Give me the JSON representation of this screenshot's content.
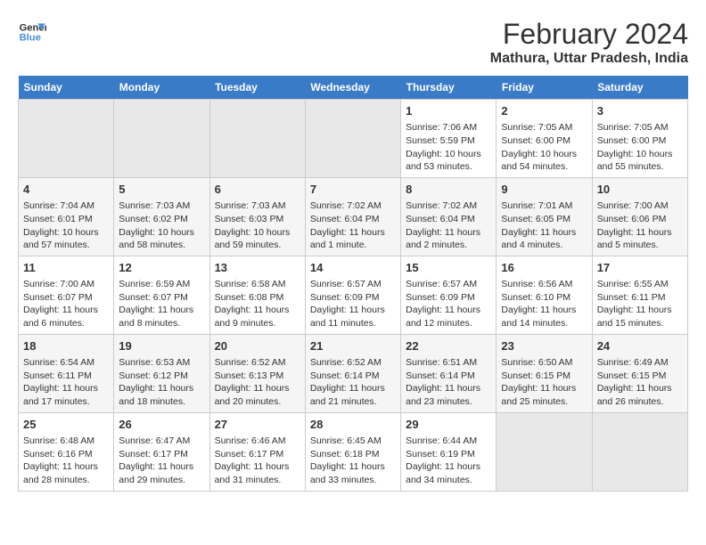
{
  "logo": {
    "line1": "General",
    "line2": "Blue"
  },
  "title": "February 2024",
  "subtitle": "Mathura, Uttar Pradesh, India",
  "headers": [
    "Sunday",
    "Monday",
    "Tuesday",
    "Wednesday",
    "Thursday",
    "Friday",
    "Saturday"
  ],
  "weeks": [
    [
      {
        "day": "",
        "empty": true
      },
      {
        "day": "",
        "empty": true
      },
      {
        "day": "",
        "empty": true
      },
      {
        "day": "",
        "empty": true
      },
      {
        "day": "1",
        "sunrise": "7:06 AM",
        "sunset": "5:59 PM",
        "daylight": "10 hours and 53 minutes."
      },
      {
        "day": "2",
        "sunrise": "7:05 AM",
        "sunset": "6:00 PM",
        "daylight": "10 hours and 54 minutes."
      },
      {
        "day": "3",
        "sunrise": "7:05 AM",
        "sunset": "6:00 PM",
        "daylight": "10 hours and 55 minutes."
      }
    ],
    [
      {
        "day": "4",
        "sunrise": "7:04 AM",
        "sunset": "6:01 PM",
        "daylight": "10 hours and 57 minutes."
      },
      {
        "day": "5",
        "sunrise": "7:03 AM",
        "sunset": "6:02 PM",
        "daylight": "10 hours and 58 minutes."
      },
      {
        "day": "6",
        "sunrise": "7:03 AM",
        "sunset": "6:03 PM",
        "daylight": "10 hours and 59 minutes."
      },
      {
        "day": "7",
        "sunrise": "7:02 AM",
        "sunset": "6:04 PM",
        "daylight": "11 hours and 1 minute."
      },
      {
        "day": "8",
        "sunrise": "7:02 AM",
        "sunset": "6:04 PM",
        "daylight": "11 hours and 2 minutes."
      },
      {
        "day": "9",
        "sunrise": "7:01 AM",
        "sunset": "6:05 PM",
        "daylight": "11 hours and 4 minutes."
      },
      {
        "day": "10",
        "sunrise": "7:00 AM",
        "sunset": "6:06 PM",
        "daylight": "11 hours and 5 minutes."
      }
    ],
    [
      {
        "day": "11",
        "sunrise": "7:00 AM",
        "sunset": "6:07 PM",
        "daylight": "11 hours and 6 minutes."
      },
      {
        "day": "12",
        "sunrise": "6:59 AM",
        "sunset": "6:07 PM",
        "daylight": "11 hours and 8 minutes."
      },
      {
        "day": "13",
        "sunrise": "6:58 AM",
        "sunset": "6:08 PM",
        "daylight": "11 hours and 9 minutes."
      },
      {
        "day": "14",
        "sunrise": "6:57 AM",
        "sunset": "6:09 PM",
        "daylight": "11 hours and 11 minutes."
      },
      {
        "day": "15",
        "sunrise": "6:57 AM",
        "sunset": "6:09 PM",
        "daylight": "11 hours and 12 minutes."
      },
      {
        "day": "16",
        "sunrise": "6:56 AM",
        "sunset": "6:10 PM",
        "daylight": "11 hours and 14 minutes."
      },
      {
        "day": "17",
        "sunrise": "6:55 AM",
        "sunset": "6:11 PM",
        "daylight": "11 hours and 15 minutes."
      }
    ],
    [
      {
        "day": "18",
        "sunrise": "6:54 AM",
        "sunset": "6:11 PM",
        "daylight": "11 hours and 17 minutes."
      },
      {
        "day": "19",
        "sunrise": "6:53 AM",
        "sunset": "6:12 PM",
        "daylight": "11 hours and 18 minutes."
      },
      {
        "day": "20",
        "sunrise": "6:52 AM",
        "sunset": "6:13 PM",
        "daylight": "11 hours and 20 minutes."
      },
      {
        "day": "21",
        "sunrise": "6:52 AM",
        "sunset": "6:14 PM",
        "daylight": "11 hours and 21 minutes."
      },
      {
        "day": "22",
        "sunrise": "6:51 AM",
        "sunset": "6:14 PM",
        "daylight": "11 hours and 23 minutes."
      },
      {
        "day": "23",
        "sunrise": "6:50 AM",
        "sunset": "6:15 PM",
        "daylight": "11 hours and 25 minutes."
      },
      {
        "day": "24",
        "sunrise": "6:49 AM",
        "sunset": "6:15 PM",
        "daylight": "11 hours and 26 minutes."
      }
    ],
    [
      {
        "day": "25",
        "sunrise": "6:48 AM",
        "sunset": "6:16 PM",
        "daylight": "11 hours and 28 minutes."
      },
      {
        "day": "26",
        "sunrise": "6:47 AM",
        "sunset": "6:17 PM",
        "daylight": "11 hours and 29 minutes."
      },
      {
        "day": "27",
        "sunrise": "6:46 AM",
        "sunset": "6:17 PM",
        "daylight": "11 hours and 31 minutes."
      },
      {
        "day": "28",
        "sunrise": "6:45 AM",
        "sunset": "6:18 PM",
        "daylight": "11 hours and 33 minutes."
      },
      {
        "day": "29",
        "sunrise": "6:44 AM",
        "sunset": "6:19 PM",
        "daylight": "11 hours and 34 minutes."
      },
      {
        "day": "",
        "empty": true
      },
      {
        "day": "",
        "empty": true
      }
    ]
  ]
}
